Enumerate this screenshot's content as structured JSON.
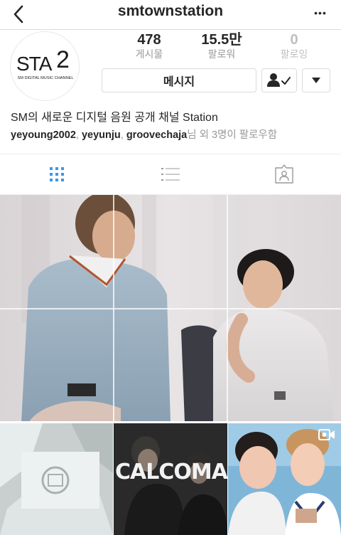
{
  "header": {
    "username": "smtownstation",
    "back_icon": "chevron-left-icon",
    "more_label": "•••"
  },
  "profile": {
    "avatar_logo_main": "STA",
    "avatar_logo_num": "2",
    "avatar_logo_sub": "SM DIGITAL MUSIC CHANNEL",
    "stats": [
      {
        "value": "478",
        "label": "게시물"
      },
      {
        "value": "15.5만",
        "label": "팔로워"
      },
      {
        "value": "0",
        "label": "팔로잉"
      }
    ],
    "message_label": "메시지",
    "follow_icon": "person-check-icon",
    "dropdown_icon": "caret-down-icon",
    "bio": "SM의 새로운 디지털 음원 공개 채널 Station",
    "followed_by": {
      "users": [
        "yeyoung2002",
        "yeyunju",
        "groovechaja"
      ],
      "sep": ", ",
      "suffix": "님 외 3명이 팔로우함"
    }
  },
  "tabs": [
    {
      "name": "grid",
      "icon": "grid-icon",
      "active": true
    },
    {
      "name": "list",
      "icon": "list-icon",
      "active": false
    },
    {
      "name": "tagged",
      "icon": "tagged-person-icon",
      "active": false
    }
  ],
  "posts": {
    "tile_text_calcoman": "CALCOMAN"
  },
  "colors": {
    "accent": "#3897f0",
    "muted": "#999999",
    "border": "#dbdbdb"
  }
}
